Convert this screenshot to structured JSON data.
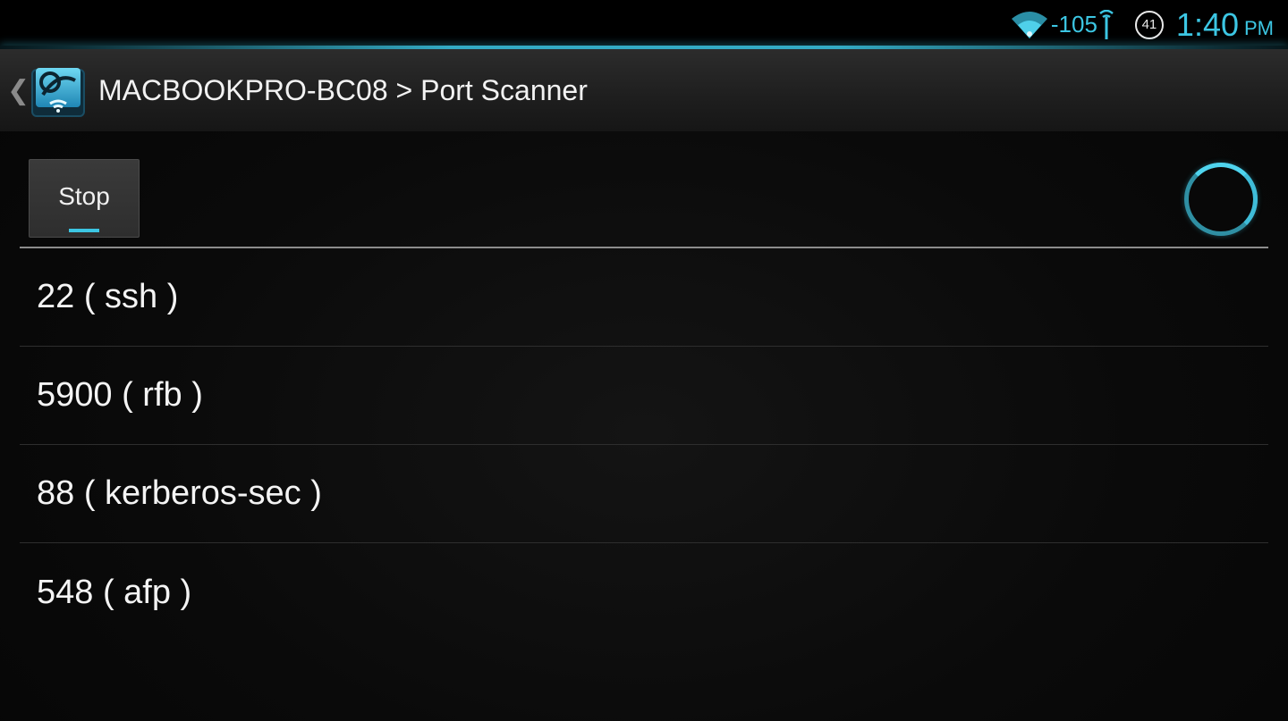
{
  "status_bar": {
    "signal_strength": "-105",
    "battery_level": "41",
    "clock_time": "1:40",
    "clock_ampm": "PM",
    "icons": [
      "wifi-icon",
      "antenna-icon",
      "battery-icon"
    ],
    "accent_color": "#3cc6e3"
  },
  "action_bar": {
    "title": "MACBOOKPRO-BC08 > Port Scanner",
    "up_glyph": "❮",
    "app_icon": "network-scanner-app-icon"
  },
  "toolbar": {
    "stop_label": "Stop",
    "spinner": "progress-spinner"
  },
  "ports": [
    {
      "label": "22 ( ssh )"
    },
    {
      "label": "5900 ( rfb )"
    },
    {
      "label": "88 ( kerberos-sec )"
    },
    {
      "label": "548 ( afp )"
    }
  ]
}
